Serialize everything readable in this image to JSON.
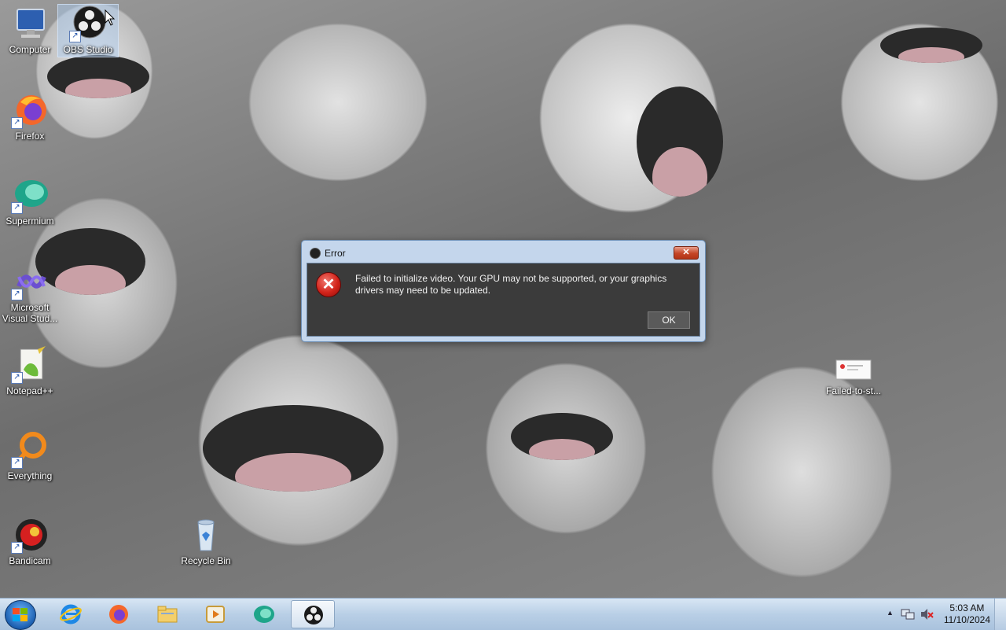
{
  "desktop": {
    "icons": [
      {
        "label": "Computer",
        "icon": "computer-icon"
      },
      {
        "label": "OBS Studio",
        "icon": "obs-icon"
      },
      {
        "label": "Firefox",
        "icon": "firefox-icon"
      },
      {
        "label": "Supermium",
        "icon": "supermium-icon"
      },
      {
        "label": "Microsoft Visual Stud...",
        "icon": "visual-studio-icon"
      },
      {
        "label": "Notepad++",
        "icon": "notepadpp-icon"
      },
      {
        "label": "Everything",
        "icon": "everything-icon"
      },
      {
        "label": "Bandicam",
        "icon": "bandicam-icon"
      },
      {
        "label": "Recycle Bin",
        "icon": "recycle-bin-icon"
      },
      {
        "label": "Failed-to-st...",
        "icon": "image-file-icon"
      }
    ]
  },
  "dialog": {
    "title": "Error",
    "close_label": "✕",
    "message": "Failed to initialize video.  Your GPU may not be supported, or your graphics drivers may need to be updated.",
    "ok_label": "OK",
    "icon": "error-icon"
  },
  "taskbar": {
    "apps": [
      "internet-explorer-icon",
      "firefox-icon",
      "file-explorer-icon",
      "media-player-icon",
      "supermium-icon",
      "obs-icon"
    ],
    "active_app": "obs-icon",
    "clock": {
      "time": "5:03 AM",
      "date": "11/10/2024"
    }
  },
  "colors": {
    "error_red": "#d2231a",
    "dialog_body": "#3b3b3b",
    "taskbar": "#b9cfe6"
  }
}
